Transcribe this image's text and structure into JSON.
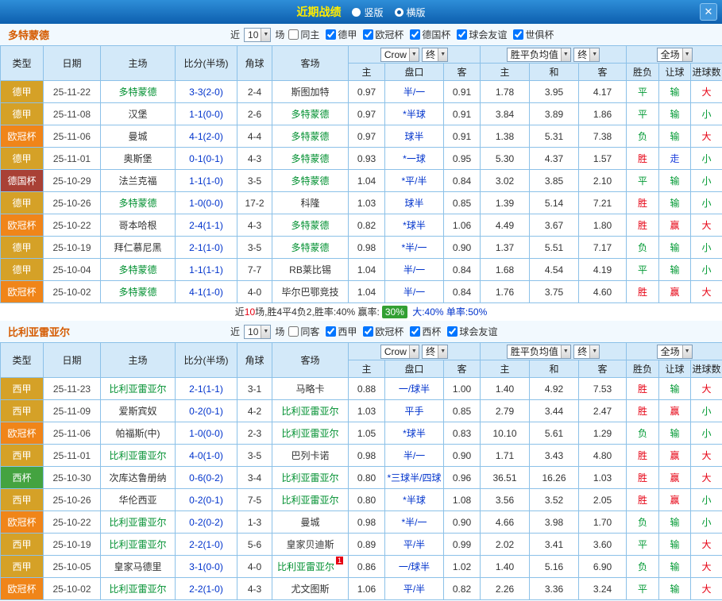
{
  "topbar": {
    "title": "近期战绩",
    "layout_options": [
      {
        "label": "竖版",
        "selected": false
      },
      {
        "label": "横版",
        "selected": true
      }
    ],
    "close": "✕"
  },
  "filter_labels": {
    "near": "近",
    "games_count": "10",
    "games": "场"
  },
  "table_header": {
    "type": "类型",
    "date": "日期",
    "home": "主场",
    "score": "比分(半场)",
    "corner": "角球",
    "away": "客场",
    "odds_source": "Crow",
    "final": "终",
    "avg_label": "胜平负均值",
    "scope": "全场",
    "sub": {
      "home_odds": "主",
      "handicap": "盘口",
      "away_odds": "客",
      "avg_home": "主",
      "avg_draw": "和",
      "avg_away": "客",
      "result": "胜负",
      "handicap_result": "让球",
      "goals": "进球数"
    }
  },
  "colors": {
    "league": {
      "德甲": "#d5a127",
      "欧冠杯": "#f08519",
      "德国杯": "#a94136",
      "西甲": "#d5a127",
      "西杯": "#44a340"
    },
    "result": {
      "胜": "#e60012",
      "平": "#009933",
      "负": "#009933",
      "赢": "#e60012",
      "输": "#009933",
      "走": "#2244dd",
      "大": "#e60012",
      "小": "#009933"
    },
    "team_highlight": "#009030",
    "score_text": "#0033cc",
    "handicap_text": "#0033cc"
  },
  "sections": [
    {
      "team": "多特蒙德",
      "filters": [
        {
          "label": "同主",
          "checked": false
        },
        {
          "label": "德甲",
          "checked": true
        },
        {
          "label": "欧冠杯",
          "checked": true
        },
        {
          "label": "德国杯",
          "checked": true
        },
        {
          "label": "球会友谊",
          "checked": true
        },
        {
          "label": "世俱杯",
          "checked": true
        }
      ],
      "rows": [
        {
          "league": "德甲",
          "date": "25-11-22",
          "home": "多特蒙德",
          "score": "3-3(2-0)",
          "corner": "2-4",
          "away": "斯图加特",
          "odds_home": "0.97",
          "handicap": "半/一",
          "odds_away": "0.91",
          "avg_home": "1.78",
          "avg_draw": "3.95",
          "avg_away": "4.17",
          "result": "平",
          "handicap_result": "输",
          "goals": "大"
        },
        {
          "league": "德甲",
          "date": "25-11-08",
          "home": "汉堡",
          "score": "1-1(0-0)",
          "corner": "2-6",
          "away": "多特蒙德",
          "odds_home": "0.97",
          "handicap": "*半球",
          "odds_away": "0.91",
          "avg_home": "3.84",
          "avg_draw": "3.89",
          "avg_away": "1.86",
          "result": "平",
          "handicap_result": "输",
          "goals": "小"
        },
        {
          "league": "欧冠杯",
          "date": "25-11-06",
          "home": "曼城",
          "score": "4-1(2-0)",
          "corner": "4-4",
          "away": "多特蒙德",
          "odds_home": "0.97",
          "handicap": "球半",
          "odds_away": "0.91",
          "avg_home": "1.38",
          "avg_draw": "5.31",
          "avg_away": "7.38",
          "result": "负",
          "handicap_result": "输",
          "goals": "大"
        },
        {
          "league": "德甲",
          "date": "25-11-01",
          "home": "奥斯堡",
          "score": "0-1(0-1)",
          "corner": "4-3",
          "away": "多特蒙德",
          "odds_home": "0.93",
          "handicap": "*一球",
          "odds_away": "0.95",
          "avg_home": "5.30",
          "avg_draw": "4.37",
          "avg_away": "1.57",
          "result": "胜",
          "handicap_result": "走",
          "goals": "小"
        },
        {
          "league": "德国杯",
          "date": "25-10-29",
          "home": "法兰克福",
          "score": "1-1(1-0)",
          "corner": "3-5",
          "away": "多特蒙德",
          "odds_home": "1.04",
          "handicap": "*平/半",
          "odds_away": "0.84",
          "avg_home": "3.02",
          "avg_draw": "3.85",
          "avg_away": "2.10",
          "result": "平",
          "handicap_result": "输",
          "goals": "小"
        },
        {
          "league": "德甲",
          "date": "25-10-26",
          "home": "多特蒙德",
          "score": "1-0(0-0)",
          "corner": "17-2",
          "away": "科隆",
          "odds_home": "1.03",
          "handicap": "球半",
          "odds_away": "0.85",
          "avg_home": "1.39",
          "avg_draw": "5.14",
          "avg_away": "7.21",
          "result": "胜",
          "handicap_result": "输",
          "goals": "小"
        },
        {
          "league": "欧冠杯",
          "date": "25-10-22",
          "home": "哥本哈根",
          "score": "2-4(1-1)",
          "corner": "4-3",
          "away": "多特蒙德",
          "odds_home": "0.82",
          "handicap": "*球半",
          "odds_away": "1.06",
          "avg_home": "4.49",
          "avg_draw": "3.67",
          "avg_away": "1.80",
          "result": "胜",
          "handicap_result": "赢",
          "goals": "大"
        },
        {
          "league": "德甲",
          "date": "25-10-19",
          "home": "拜仁慕尼黑",
          "score": "2-1(1-0)",
          "corner": "3-5",
          "away": "多特蒙德",
          "odds_home": "0.98",
          "handicap": "*半/一",
          "odds_away": "0.90",
          "avg_home": "1.37",
          "avg_draw": "5.51",
          "avg_away": "7.17",
          "result": "负",
          "handicap_result": "输",
          "goals": "小"
        },
        {
          "league": "德甲",
          "date": "25-10-04",
          "home": "多特蒙德",
          "score": "1-1(1-1)",
          "corner": "7-7",
          "away": "RB莱比锡",
          "odds_home": "1.04",
          "handicap": "半/一",
          "odds_away": "0.84",
          "avg_home": "1.68",
          "avg_draw": "4.54",
          "avg_away": "4.19",
          "result": "平",
          "handicap_result": "输",
          "goals": "小"
        },
        {
          "league": "欧冠杯",
          "date": "25-10-02",
          "home": "多特蒙德",
          "score": "4-1(1-0)",
          "corner": "4-0",
          "away": "毕尔巴鄂竞技",
          "odds_home": "1.04",
          "handicap": "半/一",
          "odds_away": "0.84",
          "avg_home": "1.76",
          "avg_draw": "3.75",
          "avg_away": "4.60",
          "result": "胜",
          "handicap_result": "赢",
          "goals": "大"
        }
      ],
      "summary": {
        "prefix": "近",
        "count": "10",
        "middle": "场,胜4平4负2,胜率:40% 赢率:",
        "badge": "30%",
        "suffix": " 大:40% 单率:50%"
      }
    },
    {
      "team": "比利亚雷亚尔",
      "filters": [
        {
          "label": "同客",
          "checked": false
        },
        {
          "label": "西甲",
          "checked": true
        },
        {
          "label": "欧冠杯",
          "checked": true
        },
        {
          "label": "西杯",
          "checked": true
        },
        {
          "label": "球会友谊",
          "checked": true
        }
      ],
      "rows": [
        {
          "league": "西甲",
          "date": "25-11-23",
          "home": "比利亚雷亚尔",
          "score": "2-1(1-1)",
          "corner": "3-1",
          "away": "马略卡",
          "odds_home": "0.88",
          "handicap": "一/球半",
          "odds_away": "1.00",
          "avg_home": "1.40",
          "avg_draw": "4.92",
          "avg_away": "7.53",
          "result": "胜",
          "handicap_result": "输",
          "goals": "大"
        },
        {
          "league": "西甲",
          "date": "25-11-09",
          "home": "爱斯宾奴",
          "score": "0-2(0-1)",
          "corner": "4-2",
          "away": "比利亚雷亚尔",
          "odds_home": "1.03",
          "handicap": "平手",
          "odds_away": "0.85",
          "avg_home": "2.79",
          "avg_draw": "3.44",
          "avg_away": "2.47",
          "result": "胜",
          "handicap_result": "赢",
          "goals": "小"
        },
        {
          "league": "欧冠杯",
          "date": "25-11-06",
          "home": "帕福斯(中)",
          "score": "1-0(0-0)",
          "corner": "2-3",
          "away": "比利亚雷亚尔",
          "odds_home": "1.05",
          "handicap": "*球半",
          "odds_away": "0.83",
          "avg_home": "10.10",
          "avg_draw": "5.61",
          "avg_away": "1.29",
          "result": "负",
          "handicap_result": "输",
          "goals": "小"
        },
        {
          "league": "西甲",
          "date": "25-11-01",
          "home": "比利亚雷亚尔",
          "score": "4-0(1-0)",
          "corner": "3-5",
          "away": "巴列卡诺",
          "odds_home": "0.98",
          "handicap": "半/一",
          "odds_away": "0.90",
          "avg_home": "1.71",
          "avg_draw": "3.43",
          "avg_away": "4.80",
          "result": "胜",
          "handicap_result": "赢",
          "goals": "大"
        },
        {
          "league": "西杯",
          "date": "25-10-30",
          "home": "次库达鲁册纳",
          "score": "0-6(0-2)",
          "corner": "3-4",
          "away": "比利亚雷亚尔",
          "odds_home": "0.80",
          "handicap": "*三球半/四球",
          "odds_away": "0.96",
          "avg_home": "36.51",
          "avg_draw": "16.26",
          "avg_away": "1.03",
          "result": "胜",
          "handicap_result": "赢",
          "goals": "大"
        },
        {
          "league": "西甲",
          "date": "25-10-26",
          "home": "华伦西亚",
          "score": "0-2(0-1)",
          "corner": "7-5",
          "away": "比利亚雷亚尔",
          "odds_home": "0.80",
          "handicap": "*半球",
          "odds_away": "1.08",
          "avg_home": "3.56",
          "avg_draw": "3.52",
          "avg_away": "2.05",
          "result": "胜",
          "handicap_result": "赢",
          "goals": "小"
        },
        {
          "league": "欧冠杯",
          "date": "25-10-22",
          "home": "比利亚雷亚尔",
          "score": "0-2(0-2)",
          "corner": "1-3",
          "away": "曼城",
          "odds_home": "0.98",
          "handicap": "*半/一",
          "odds_away": "0.90",
          "avg_home": "4.66",
          "avg_draw": "3.98",
          "avg_away": "1.70",
          "result": "负",
          "handicap_result": "输",
          "goals": "小"
        },
        {
          "league": "西甲",
          "date": "25-10-19",
          "home": "比利亚雷亚尔",
          "score": "2-2(1-0)",
          "corner": "5-6",
          "away": "皇家贝迪斯",
          "odds_home": "0.89",
          "handicap": "平/半",
          "odds_away": "0.99",
          "avg_home": "2.02",
          "avg_draw": "3.41",
          "avg_away": "3.60",
          "result": "平",
          "handicap_result": "输",
          "goals": "大"
        },
        {
          "league": "西甲",
          "date": "25-10-05",
          "home": "皇家马德里",
          "score": "3-1(0-0)",
          "corner": "4-0",
          "away": "比利亚雷亚尔",
          "red": "1",
          "odds_home": "0.86",
          "handicap": "一/球半",
          "odds_away": "1.02",
          "avg_home": "1.40",
          "avg_draw": "5.16",
          "avg_away": "6.90",
          "result": "负",
          "handicap_result": "输",
          "goals": "大"
        },
        {
          "league": "欧冠杯",
          "date": "25-10-02",
          "home": "比利亚雷亚尔",
          "score": "2-2(1-0)",
          "corner": "4-3",
          "away": "尤文图斯",
          "odds_home": "1.06",
          "handicap": "平/半",
          "odds_away": "0.82",
          "avg_home": "2.26",
          "avg_draw": "3.36",
          "avg_away": "3.24",
          "result": "平",
          "handicap_result": "输",
          "goals": "大"
        }
      ]
    }
  ]
}
